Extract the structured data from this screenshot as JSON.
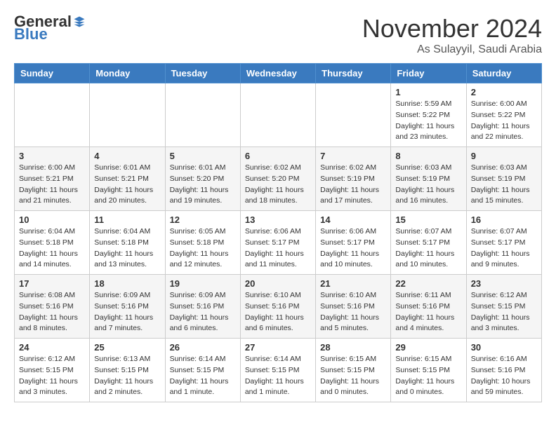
{
  "header": {
    "logo_general": "General",
    "logo_blue": "Blue",
    "month_title": "November 2024",
    "location": "As Sulayyil, Saudi Arabia"
  },
  "days_of_week": [
    "Sunday",
    "Monday",
    "Tuesday",
    "Wednesday",
    "Thursday",
    "Friday",
    "Saturday"
  ],
  "weeks": [
    [
      {
        "day": "",
        "info": ""
      },
      {
        "day": "",
        "info": ""
      },
      {
        "day": "",
        "info": ""
      },
      {
        "day": "",
        "info": ""
      },
      {
        "day": "",
        "info": ""
      },
      {
        "day": "1",
        "info": "Sunrise: 5:59 AM\nSunset: 5:22 PM\nDaylight: 11 hours\nand 23 minutes."
      },
      {
        "day": "2",
        "info": "Sunrise: 6:00 AM\nSunset: 5:22 PM\nDaylight: 11 hours\nand 22 minutes."
      }
    ],
    [
      {
        "day": "3",
        "info": "Sunrise: 6:00 AM\nSunset: 5:21 PM\nDaylight: 11 hours\nand 21 minutes."
      },
      {
        "day": "4",
        "info": "Sunrise: 6:01 AM\nSunset: 5:21 PM\nDaylight: 11 hours\nand 20 minutes."
      },
      {
        "day": "5",
        "info": "Sunrise: 6:01 AM\nSunset: 5:20 PM\nDaylight: 11 hours\nand 19 minutes."
      },
      {
        "day": "6",
        "info": "Sunrise: 6:02 AM\nSunset: 5:20 PM\nDaylight: 11 hours\nand 18 minutes."
      },
      {
        "day": "7",
        "info": "Sunrise: 6:02 AM\nSunset: 5:19 PM\nDaylight: 11 hours\nand 17 minutes."
      },
      {
        "day": "8",
        "info": "Sunrise: 6:03 AM\nSunset: 5:19 PM\nDaylight: 11 hours\nand 16 minutes."
      },
      {
        "day": "9",
        "info": "Sunrise: 6:03 AM\nSunset: 5:19 PM\nDaylight: 11 hours\nand 15 minutes."
      }
    ],
    [
      {
        "day": "10",
        "info": "Sunrise: 6:04 AM\nSunset: 5:18 PM\nDaylight: 11 hours\nand 14 minutes."
      },
      {
        "day": "11",
        "info": "Sunrise: 6:04 AM\nSunset: 5:18 PM\nDaylight: 11 hours\nand 13 minutes."
      },
      {
        "day": "12",
        "info": "Sunrise: 6:05 AM\nSunset: 5:18 PM\nDaylight: 11 hours\nand 12 minutes."
      },
      {
        "day": "13",
        "info": "Sunrise: 6:06 AM\nSunset: 5:17 PM\nDaylight: 11 hours\nand 11 minutes."
      },
      {
        "day": "14",
        "info": "Sunrise: 6:06 AM\nSunset: 5:17 PM\nDaylight: 11 hours\nand 10 minutes."
      },
      {
        "day": "15",
        "info": "Sunrise: 6:07 AM\nSunset: 5:17 PM\nDaylight: 11 hours\nand 10 minutes."
      },
      {
        "day": "16",
        "info": "Sunrise: 6:07 AM\nSunset: 5:17 PM\nDaylight: 11 hours\nand 9 minutes."
      }
    ],
    [
      {
        "day": "17",
        "info": "Sunrise: 6:08 AM\nSunset: 5:16 PM\nDaylight: 11 hours\nand 8 minutes."
      },
      {
        "day": "18",
        "info": "Sunrise: 6:09 AM\nSunset: 5:16 PM\nDaylight: 11 hours\nand 7 minutes."
      },
      {
        "day": "19",
        "info": "Sunrise: 6:09 AM\nSunset: 5:16 PM\nDaylight: 11 hours\nand 6 minutes."
      },
      {
        "day": "20",
        "info": "Sunrise: 6:10 AM\nSunset: 5:16 PM\nDaylight: 11 hours\nand 6 minutes."
      },
      {
        "day": "21",
        "info": "Sunrise: 6:10 AM\nSunset: 5:16 PM\nDaylight: 11 hours\nand 5 minutes."
      },
      {
        "day": "22",
        "info": "Sunrise: 6:11 AM\nSunset: 5:16 PM\nDaylight: 11 hours\nand 4 minutes."
      },
      {
        "day": "23",
        "info": "Sunrise: 6:12 AM\nSunset: 5:15 PM\nDaylight: 11 hours\nand 3 minutes."
      }
    ],
    [
      {
        "day": "24",
        "info": "Sunrise: 6:12 AM\nSunset: 5:15 PM\nDaylight: 11 hours\nand 3 minutes."
      },
      {
        "day": "25",
        "info": "Sunrise: 6:13 AM\nSunset: 5:15 PM\nDaylight: 11 hours\nand 2 minutes."
      },
      {
        "day": "26",
        "info": "Sunrise: 6:14 AM\nSunset: 5:15 PM\nDaylight: 11 hours\nand 1 minute."
      },
      {
        "day": "27",
        "info": "Sunrise: 6:14 AM\nSunset: 5:15 PM\nDaylight: 11 hours\nand 1 minute."
      },
      {
        "day": "28",
        "info": "Sunrise: 6:15 AM\nSunset: 5:15 PM\nDaylight: 11 hours\nand 0 minutes."
      },
      {
        "day": "29",
        "info": "Sunrise: 6:15 AM\nSunset: 5:15 PM\nDaylight: 11 hours\nand 0 minutes."
      },
      {
        "day": "30",
        "info": "Sunrise: 6:16 AM\nSunset: 5:16 PM\nDaylight: 10 hours\nand 59 minutes."
      }
    ]
  ]
}
